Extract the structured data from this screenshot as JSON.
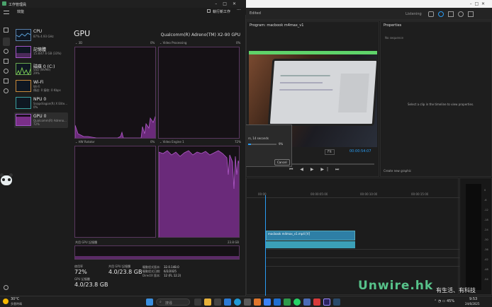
{
  "bg_app": {
    "menu_item": "Edited",
    "right_label": "Listening",
    "program_monitor_title": "Program: macbook m4max_v1",
    "properties_title": "Properties",
    "no_sequence": "No sequence",
    "properties_hint": "Select a clip in the timeline to view properties.",
    "timecode": "00:00:54:07",
    "fit_label": "Fit",
    "create_graphic": "Create new graphic",
    "clip_name": "macbook m4max_v1.mp4 [V]",
    "dialog_text": "rs, 14 seconds",
    "dialog_percent": "9%",
    "dialog_cancel": "Cancel",
    "timeline_marks": [
      "00:00",
      "00:00:05:00",
      "00:00:10:00",
      "00:00:15:00"
    ],
    "meter_scale": [
      "0",
      "-6",
      "-12",
      "-18",
      "-24",
      "-30",
      "-36",
      "-42",
      "-48",
      "-54"
    ]
  },
  "task_manager": {
    "title": "工作管理員",
    "section": "效能",
    "run_new_task": "執行新工作",
    "processes": [
      {
        "name": "CPU",
        "sub1": "87%  4.93 GHz",
        "sub2": ""
      },
      {
        "name": "記憶體",
        "sub1": "15.8/47.6 GB (33%)",
        "sub2": ""
      },
      {
        "name": "磁碟 0 (C:)",
        "sub1": "SSD (NVMe)",
        "sub2": "29%"
      },
      {
        "name": "Wi-Fi",
        "sub1": "Wi-Fi",
        "sub2": "傳送: 0 接收: 0 Kbps"
      },
      {
        "name": "NPU 0",
        "sub1": "Snapdragon(R) X Elite...",
        "sub2": "0%"
      },
      {
        "name": "GPU 0",
        "sub1": "Qualcomm(R) Adreno...",
        "sub2": "72%"
      }
    ],
    "gpu_title": "GPU",
    "gpu_model": "Qualcomm(R) Adreno(TM) X2-90 GPU",
    "engines": [
      {
        "name": "3D",
        "pct": "0%"
      },
      {
        "name": "Video Processing",
        "pct": "0%"
      },
      {
        "name": "HW Rotator",
        "pct": "0%"
      },
      {
        "name": "Video Engine 1",
        "pct": "72%"
      }
    ],
    "shared_mem_label": "共用 GPU 記憶體",
    "shared_mem_value": "23.8 GB",
    "util_label": "使用率",
    "util_value": "72%",
    "shared_label": "共用 GPU 記憶體",
    "shared_value": "4.0/23.8 GB",
    "gpu_mem_label": "GPU 記憶體",
    "gpu_mem_value": "4.0/23.8 GB",
    "driver": [
      {
        "k": "驅動程式版本:",
        "v": "32.0.148.0"
      },
      {
        "k": "驅動程式日期:",
        "v": "6/2/2025"
      },
      {
        "k": "DirectX 版本:",
        "v": "12 (FL 12.2)"
      }
    ]
  },
  "taskbar": {
    "weather_temp": "30°C",
    "weather_desc": "多雲時晴",
    "search_placeholder": "搜尋",
    "time": "9:53",
    "date": "24/6/2025",
    "battery": "45%"
  },
  "watermark": "Unwire.hk",
  "watermark_sub": "有生活、有科技"
}
